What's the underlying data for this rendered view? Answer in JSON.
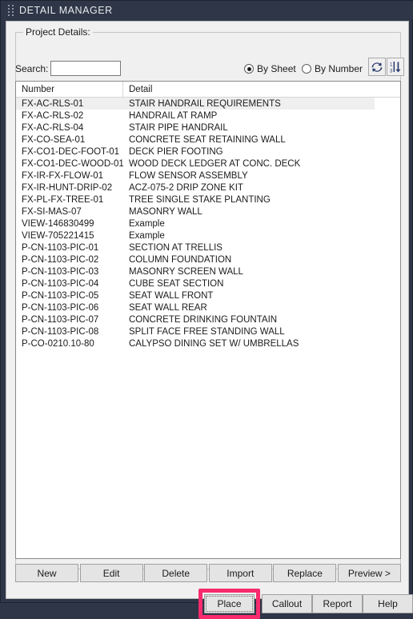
{
  "window": {
    "title": "DETAIL MANAGER",
    "grip_icon": "drag-handle-dots",
    "titlebar_color": "#2e3647",
    "body_color": "#f0f0f0"
  },
  "group": {
    "legend": "Project Details:"
  },
  "search": {
    "label": "Search:",
    "value": "",
    "placeholder": ""
  },
  "view_mode": {
    "options": [
      {
        "label": "By Sheet",
        "checked": true
      },
      {
        "label": "By Number",
        "checked": false
      }
    ]
  },
  "toolbar": {
    "refresh": {
      "icon": "refresh-icon",
      "tooltip": "Refresh",
      "color": "#2b3a6b"
    },
    "sort": {
      "icon": "sort-numeric-descending-icon",
      "tooltip": "Sort",
      "color": "#2b3a6b"
    }
  },
  "list": {
    "columns": [
      "Number",
      "Detail"
    ],
    "selected_index": 0,
    "selection_color": "#efefef",
    "rows": [
      {
        "number": "FX-AC-RLS-01",
        "detail": "STAIR HANDRAIL REQUIREMENTS"
      },
      {
        "number": "FX-AC-RLS-02",
        "detail": "HANDRAIL AT RAMP"
      },
      {
        "number": "FX-AC-RLS-04",
        "detail": "STAIR PIPE HANDRAIL"
      },
      {
        "number": "FX-CO-SEA-01",
        "detail": "CONCRETE SEAT RETAINING WALL"
      },
      {
        "number": "FX-CO1-DEC-FOOT-01",
        "detail": "DECK PIER FOOTING"
      },
      {
        "number": "FX-CO1-DEC-WOOD-01",
        "detail": "WOOD DECK LEDGER AT CONC. DECK"
      },
      {
        "number": "FX-IR-FX-FLOW-01",
        "detail": "FLOW SENSOR ASSEMBLY"
      },
      {
        "number": "FX-IR-HUNT-DRIP-02",
        "detail": "ACZ-075-2 DRIP ZONE KIT"
      },
      {
        "number": "FX-PL-FX-TREE-01",
        "detail": "TREE SINGLE STAKE PLANTING"
      },
      {
        "number": "FX-SI-MAS-07",
        "detail": "MASONRY WALL"
      },
      {
        "number": "VIEW-146830499",
        "detail": "Example"
      },
      {
        "number": "VIEW-705221415",
        "detail": "Example"
      },
      {
        "number": "P-CN-1103-PIC-01",
        "detail": "SECTION AT TRELLIS"
      },
      {
        "number": "P-CN-1103-PIC-02",
        "detail": "COLUMN FOUNDATION"
      },
      {
        "number": "P-CN-1103-PIC-03",
        "detail": "MASONRY SCREEN WALL"
      },
      {
        "number": "P-CN-1103-PIC-04",
        "detail": "CUBE SEAT SECTION"
      },
      {
        "number": "P-CN-1103-PIC-05",
        "detail": "SEAT WALL FRONT"
      },
      {
        "number": "P-CN-1103-PIC-06",
        "detail": "SEAT WALL REAR"
      },
      {
        "number": "P-CN-1103-PIC-07",
        "detail": "CONCRETE DRINKING FOUNTAIN"
      },
      {
        "number": "P-CN-1103-PIC-08",
        "detail": "SPLIT FACE FREE STANDING WALL"
      },
      {
        "number": "P-CO-0210.10-80",
        "detail": "CALYPSO DINING SET W/ UMBRELLAS"
      }
    ]
  },
  "actions": {
    "new": "New",
    "edit": "Edit",
    "delete": "Delete",
    "import": "Import",
    "replace": "Replace",
    "preview": "Preview >"
  },
  "footer": {
    "place": "Place",
    "callout": "Callout",
    "report": "Report",
    "help": "Help",
    "highlight_color": "#f72b6d",
    "highlighted_button": "Place"
  }
}
